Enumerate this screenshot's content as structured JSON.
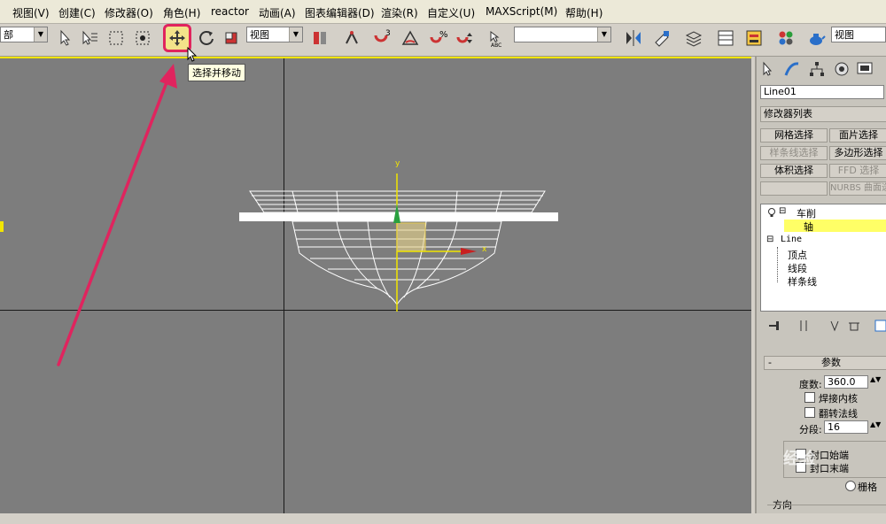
{
  "menu": {
    "items": [
      "视图(V)",
      "创建(C)",
      "修改器(O)",
      "角色(H)",
      "reactor",
      "动画(A)",
      "图表编辑器(D)",
      "渲染(R)",
      "自定义(U)",
      "MAXScript(M)",
      "帮助(H)"
    ]
  },
  "toolbar": {
    "selection_filter": "部",
    "reference_coord": "视图",
    "named_selection": "",
    "right_combo": "视图"
  },
  "tooltip": {
    "text": "选择并移动"
  },
  "viewport": {
    "axis_y_label": "y",
    "axis_x_label": "x"
  },
  "command_panel": {
    "object_name": "Line01",
    "modifier_list": "修改器列表",
    "buttons": {
      "mesh_select": "网格选择",
      "patch_select": "面片选择",
      "spline_select": "样条线选择",
      "poly_select": "多边形选择",
      "volume_select": "体积选择",
      "ffd_select": "FFD 选择",
      "nurbs_surface": "NURBS 曲面选"
    },
    "stack": {
      "lathe": "车削",
      "axis": "轴",
      "line": "Line",
      "vertex": "顶点",
      "segment": "线段",
      "spline": "样条线"
    },
    "params": {
      "header": "参数",
      "degrees_label": "度数:",
      "degrees_value": "360.0",
      "weld_core": "焊接内核",
      "flip_normals": "翻转法线",
      "segments_label": "分段:",
      "segments_value": "16",
      "cap_start": "封口始端",
      "cap_end": "封口末端",
      "grid": "栅格",
      "direction": "方向"
    }
  },
  "watermark": {
    "text": "经验"
  },
  "colors": {
    "viewport_bg": "#7d7d7d",
    "active_border": "#f2e500",
    "highlight_red": "#e0245e",
    "stack_selected": "#ffff66"
  }
}
